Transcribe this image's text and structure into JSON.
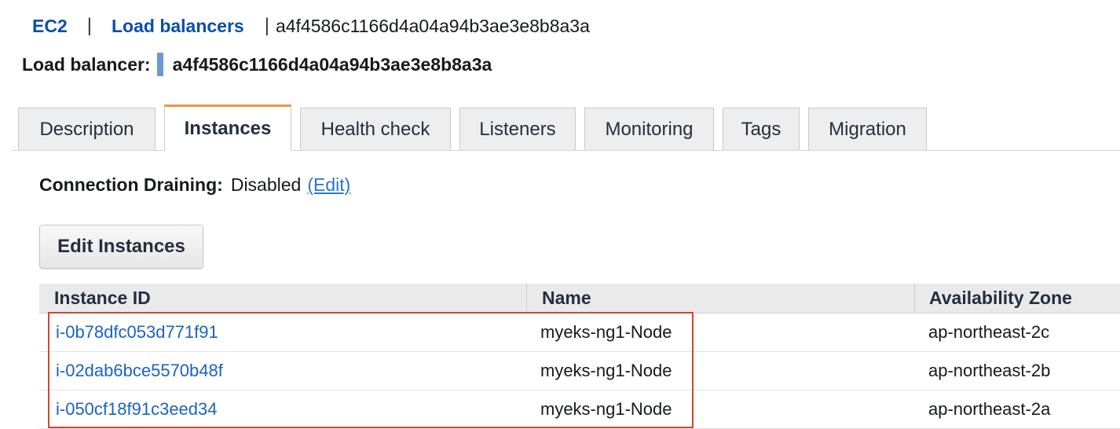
{
  "breadcrumb": {
    "service": "EC2",
    "section": "Load balancers",
    "current": "a4f4586c1166d4a04a94b3ae3e8b8a3a",
    "separator": "|"
  },
  "load_balancer": {
    "label": "Load balancer:",
    "name": "a4f4586c1166d4a04a94b3ae3e8b8a3a"
  },
  "tabs": [
    {
      "label": "Description"
    },
    {
      "label": "Instances"
    },
    {
      "label": "Health check"
    },
    {
      "label": "Listeners"
    },
    {
      "label": "Monitoring"
    },
    {
      "label": "Tags"
    },
    {
      "label": "Migration"
    }
  ],
  "active_tab": "Instances",
  "connection_draining": {
    "label": "Connection Draining:",
    "value": "Disabled",
    "edit_label": "(Edit)"
  },
  "edit_instances_label": "Edit Instances",
  "instances_table": {
    "columns": [
      "Instance ID",
      "Name",
      "Availability Zone"
    ],
    "rows": [
      {
        "instance_id": "i-0b78dfc053d771f91",
        "name": "myeks-ng1-Node",
        "zone": "ap-northeast-2c"
      },
      {
        "instance_id": "i-02dab6bce5570b48f",
        "name": "myeks-ng1-Node",
        "zone": "ap-northeast-2b"
      },
      {
        "instance_id": "i-050cf18f91c3eed34",
        "name": "myeks-ng1-Node",
        "zone": "ap-northeast-2a"
      }
    ]
  },
  "colors": {
    "link": "#0a4eaa",
    "active_tab_accent": "#e59b3a",
    "highlight": "#d4452f"
  }
}
